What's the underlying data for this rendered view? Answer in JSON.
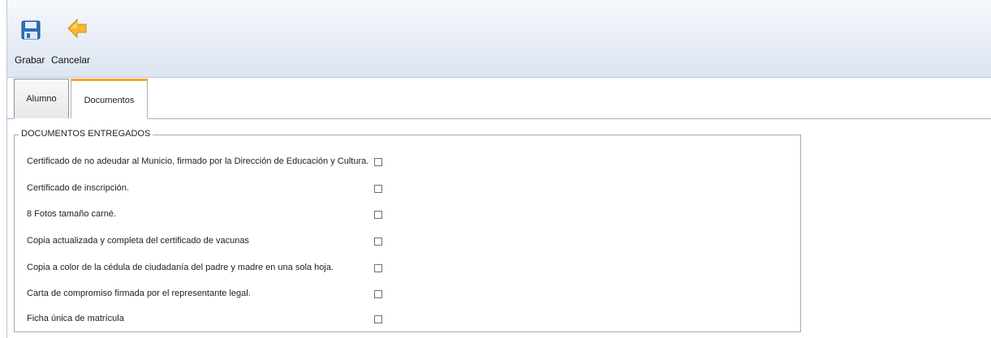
{
  "toolbar": {
    "save_label": "Grabar",
    "cancel_label": "Cancelar",
    "save_icon": "floppy-disk-icon",
    "cancel_icon": "back-arrow-icon"
  },
  "tabs": [
    {
      "label": "Alumno",
      "active": false
    },
    {
      "label": "Documentos",
      "active": true
    }
  ],
  "documents": {
    "legend": "DOCUMENTOS ENTREGADOS",
    "items": [
      {
        "label": "Certificado de no adeudar al Municio, firmado por la Dirección de Educación y Cultura.",
        "checked": false
      },
      {
        "label": "Certificado de inscripción.",
        "checked": false
      },
      {
        "label": "8 Fotos tamaño carné.",
        "checked": false
      },
      {
        "label": "Copia actualizada y completa del certificado de vacunas",
        "checked": false
      },
      {
        "label": "Copia a color de la cédula de ciudadanía del padre y madre en una sola hoja.",
        "checked": false
      },
      {
        "label": "Carta de compromiso firmada por el representante legal.",
        "checked": false
      },
      {
        "label": "Ficha única de matrícula",
        "checked": false
      }
    ]
  },
  "colors": {
    "toolbar_bg": "#dde5f1",
    "active_tab_accent": "#f5a623",
    "border": "#a9a9a9"
  }
}
